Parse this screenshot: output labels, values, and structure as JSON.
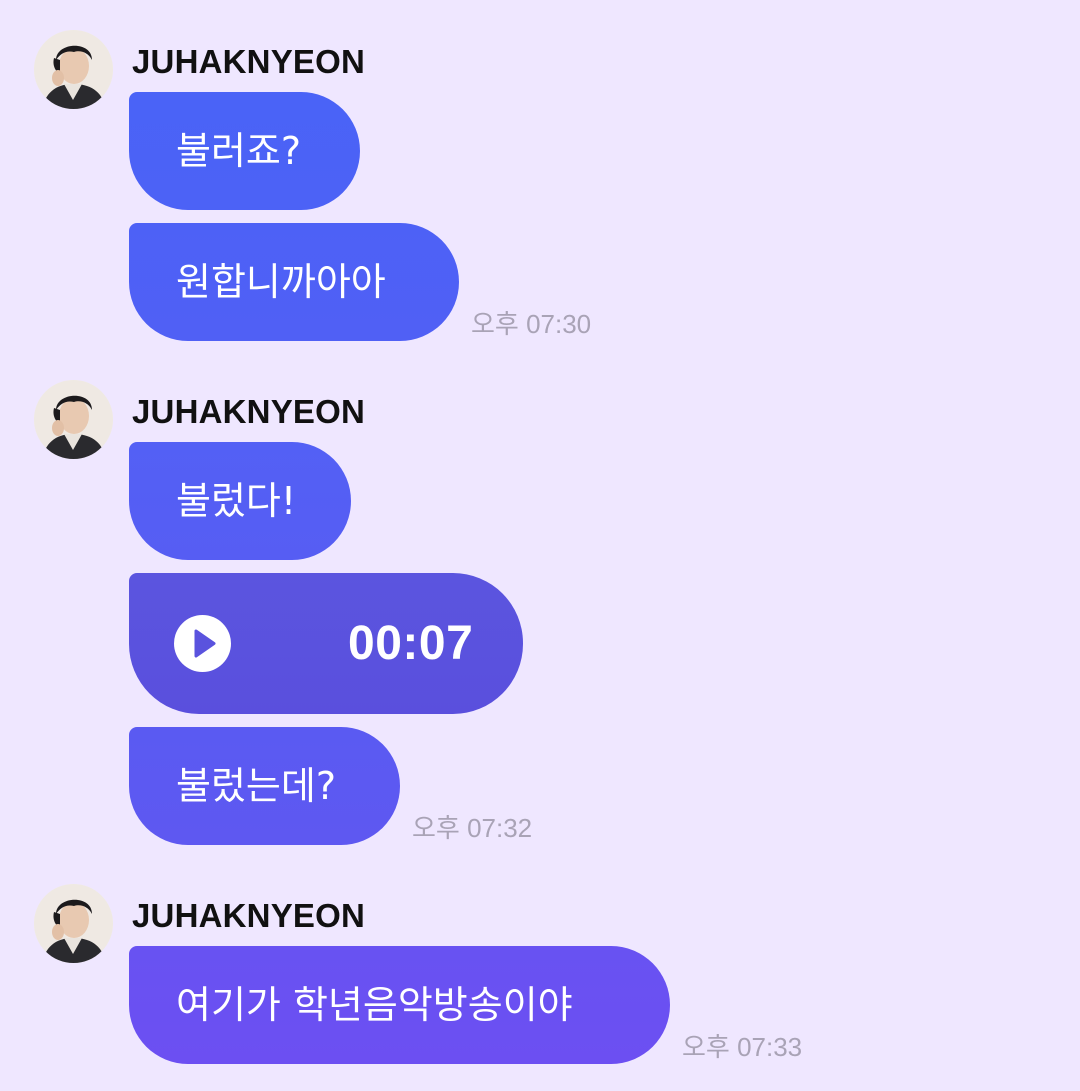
{
  "colors": {
    "background": "#EFE7FF",
    "bubble_start": "#4A63F7",
    "bubble_end": "#6A4FF2",
    "timestamp": "#A9A3B6"
  },
  "groups": [
    {
      "sender": "JUHAKNYEON",
      "messages": [
        {
          "type": "text",
          "text": "불러죠?"
        },
        {
          "type": "text",
          "text": "원합니까아아"
        }
      ],
      "time": "오후 07:30"
    },
    {
      "sender": "JUHAKNYEON",
      "messages": [
        {
          "type": "text",
          "text": "불렀다!"
        },
        {
          "type": "audio",
          "duration": "00:07",
          "icon": "play-icon"
        },
        {
          "type": "text",
          "text": "불렀는데?"
        }
      ],
      "time": "오후 07:32"
    },
    {
      "sender": "JUHAKNYEON",
      "messages": [
        {
          "type": "text",
          "text": "여기가 학년음악방송이야"
        }
      ],
      "time": "오후 07:33"
    }
  ]
}
